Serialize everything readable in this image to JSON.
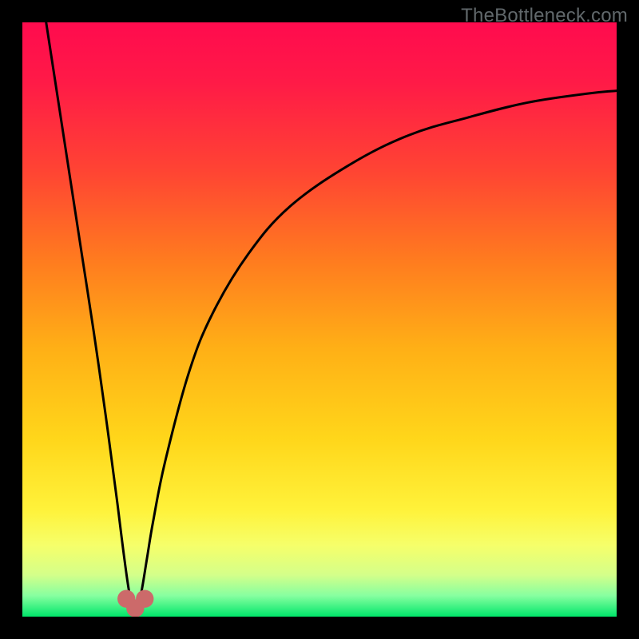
{
  "watermark": "TheBottleneck.com",
  "colors": {
    "frame": "#000000",
    "gradient_stops": [
      {
        "offset": 0.0,
        "color": "#ff0b4e"
      },
      {
        "offset": 0.1,
        "color": "#ff1a47"
      },
      {
        "offset": 0.25,
        "color": "#ff4433"
      },
      {
        "offset": 0.4,
        "color": "#ff7b1f"
      },
      {
        "offset": 0.55,
        "color": "#ffb016"
      },
      {
        "offset": 0.7,
        "color": "#ffd61a"
      },
      {
        "offset": 0.82,
        "color": "#fff23a"
      },
      {
        "offset": 0.88,
        "color": "#f6ff6a"
      },
      {
        "offset": 0.93,
        "color": "#d4ff8a"
      },
      {
        "offset": 0.965,
        "color": "#86ffa0"
      },
      {
        "offset": 1.0,
        "color": "#00e66a"
      }
    ],
    "curve": "#000000",
    "bumps": "#cc6a6a"
  },
  "chart_data": {
    "type": "line",
    "title": "",
    "xlabel": "",
    "ylabel": "",
    "xlim": [
      0,
      100
    ],
    "ylim": [
      0,
      100
    ],
    "grid": false,
    "legend": false,
    "notes": "Bottleneck-style curve: a single sharp V-shaped minimum near x≈19 touching y≈0, with a steep left wall and a slower right-side rise that turns over toward the top-right corner. Axes unlabeled; background is a vertical red→yellow→green gradient.",
    "series": [
      {
        "name": "bottleneck-curve",
        "x": [
          4,
          6,
          8,
          10,
          12,
          14,
          16,
          17,
          18,
          19,
          20,
          21,
          22,
          24,
          28,
          32,
          38,
          45,
          55,
          65,
          75,
          85,
          95,
          100
        ],
        "y": [
          100,
          87,
          74,
          61,
          48,
          34,
          19,
          11,
          4,
          0,
          4,
          10,
          16,
          26,
          41,
          51,
          61,
          69,
          76,
          81,
          84,
          86.5,
          88,
          88.5
        ]
      }
    ],
    "bumps": [
      {
        "cx": 17.5,
        "cy": 3.0,
        "r": 1.5
      },
      {
        "cx": 19.0,
        "cy": 1.4,
        "r": 1.5
      },
      {
        "cx": 20.6,
        "cy": 3.0,
        "r": 1.5
      }
    ]
  }
}
